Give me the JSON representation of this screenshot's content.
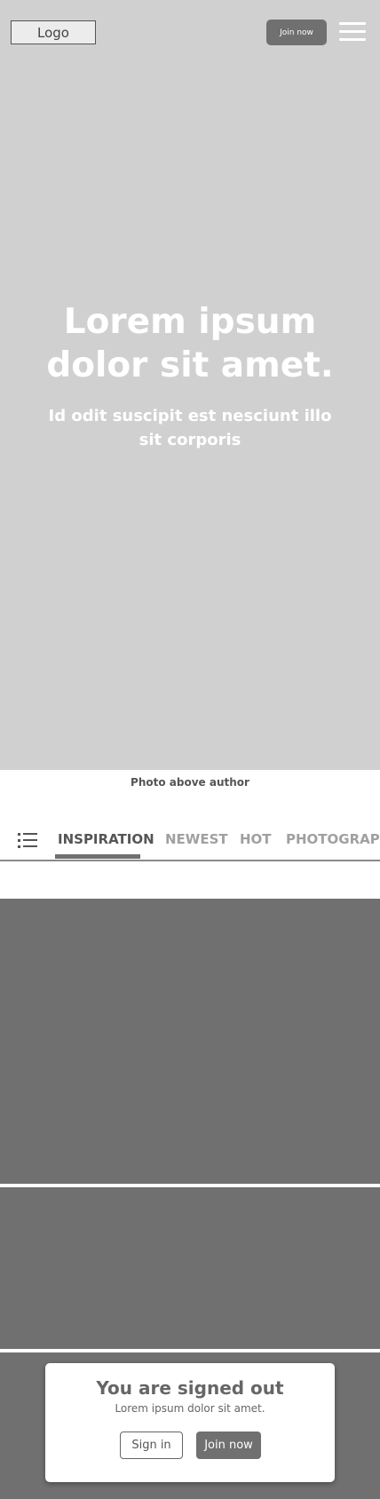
{
  "header": {
    "logo_text": "Logo",
    "join_label": "Join now",
    "menu_icon": "hamburger-menu-icon"
  },
  "hero": {
    "title": "Lorem ipsum dolor sit amet.",
    "subtitle": "Id odit suscipit est nesciunt illo sit corporis"
  },
  "caption": "Photo above author",
  "tabs": {
    "list_icon": "list-icon",
    "items": [
      {
        "label": "INSPIRATION",
        "active": true
      },
      {
        "label": "NEWEST",
        "active": false
      },
      {
        "label": "HOT",
        "active": false
      },
      {
        "label": "PHOTOGRAPHY",
        "active": false
      }
    ]
  },
  "signed_out_card": {
    "title": "You are signed out",
    "subtitle": "Lorem ipsum dolor sit amet.",
    "sign_in_label": "Sign in",
    "join_label": "Join now"
  },
  "colors": {
    "hero_bg": "#d0d0d0",
    "dark_gray": "#707070",
    "text_gray": "#555555",
    "inactive_tab": "#a0a0a0"
  }
}
